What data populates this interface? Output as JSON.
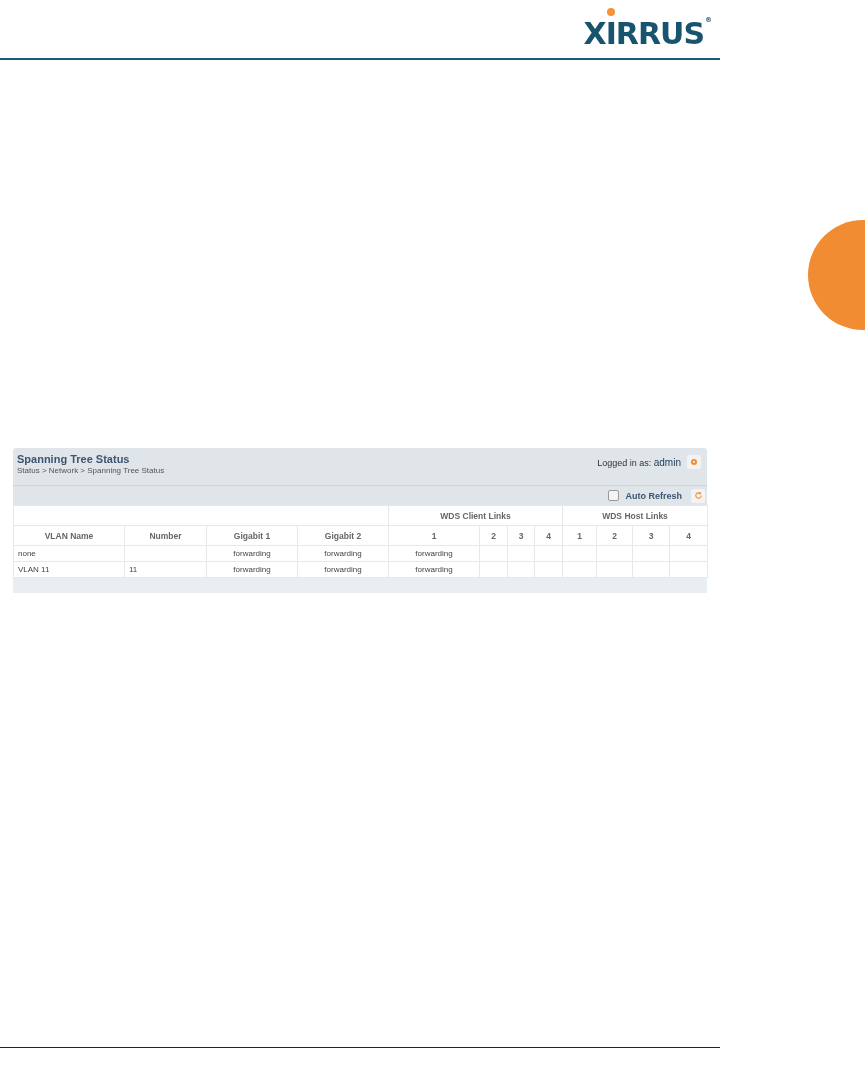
{
  "header": {
    "logo": "XIRRUS",
    "logo_mark": "®"
  },
  "panel": {
    "title": "Spanning Tree Status",
    "breadcrumb": "Status > Network > Spanning Tree Status",
    "login_label": "Logged in as:",
    "user": "admin",
    "auto_refresh": {
      "label": "Auto Refresh",
      "checked": false
    }
  },
  "table": {
    "columns": [
      "VLAN Name",
      "Number",
      "Gigabit 1",
      "Gigabit 2"
    ],
    "column_groups": [
      {
        "label": "WDS Client Links",
        "columns": [
          "1",
          "2",
          "3",
          "4"
        ]
      },
      {
        "label": "WDS Host Links",
        "columns": [
          "1",
          "2",
          "3",
          "4"
        ]
      }
    ],
    "rows": [
      {
        "cells": [
          "none",
          null,
          "forwarding",
          "forwarding",
          "forwarding",
          null,
          null,
          null,
          null,
          null,
          null,
          null
        ]
      },
      {
        "cells": [
          "VLAN 11",
          "11",
          "forwarding",
          "forwarding",
          "forwarding",
          null,
          null,
          null,
          null,
          null,
          null,
          null
        ]
      }
    ]
  }
}
